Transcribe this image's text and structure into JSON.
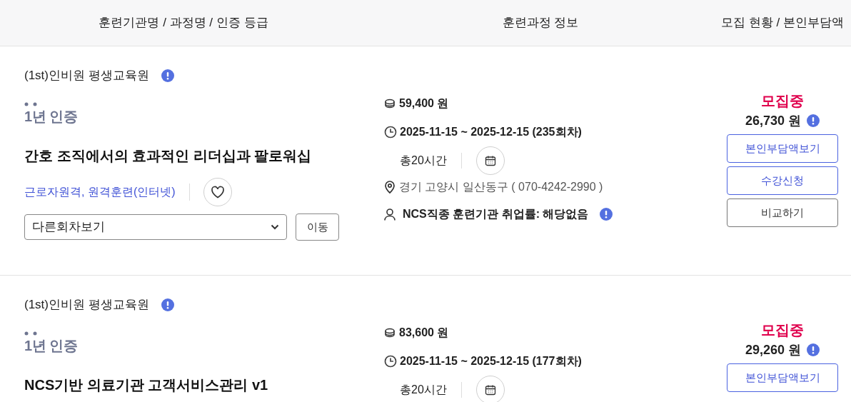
{
  "columns": [
    "훈련기관명 / 과정명 / 인증 등급",
    "훈련과정 정보",
    "모집 현황 / 본인부담액"
  ],
  "courses": [
    {
      "org": "(1st)인비원 평생교육원",
      "cert": "1년 인증",
      "title": "간호 조직에서의 효과적인 리더십과 팔로워십",
      "tags": "근로자원격, 원격훈련(인터넷)",
      "favorite": false,
      "session_select": "다른회차보기",
      "move_button": "이동",
      "price": "59,400 원",
      "period": "2025-11-15 ~ 2025-12-15 (235회차)",
      "hours": "총20시간",
      "address": "경기 고양시 일산동구 ( 070-4242-2990 )",
      "employment": "NCS직종 훈련기관 취업률: 해당없음",
      "status": "모집중",
      "self_pay": "26,730 원",
      "buttons": [
        {
          "label": "본인부담액보기",
          "kind": "primary"
        },
        {
          "label": "수강신청",
          "kind": "primary"
        },
        {
          "label": "비교하기",
          "kind": "plain"
        }
      ]
    },
    {
      "org": "(1st)인비원 평생교육원",
      "cert": "1년 인증",
      "title": "NCS기반 의료기관 고객서비스관리 v1",
      "price": "83,600 원",
      "period": "2025-11-15 ~ 2025-12-15 (177회차)",
      "hours": "총20시간",
      "status": "모집중",
      "self_pay": "29,260 원",
      "buttons": [
        {
          "label": "본인부담액보기",
          "kind": "primary"
        }
      ]
    }
  ]
}
